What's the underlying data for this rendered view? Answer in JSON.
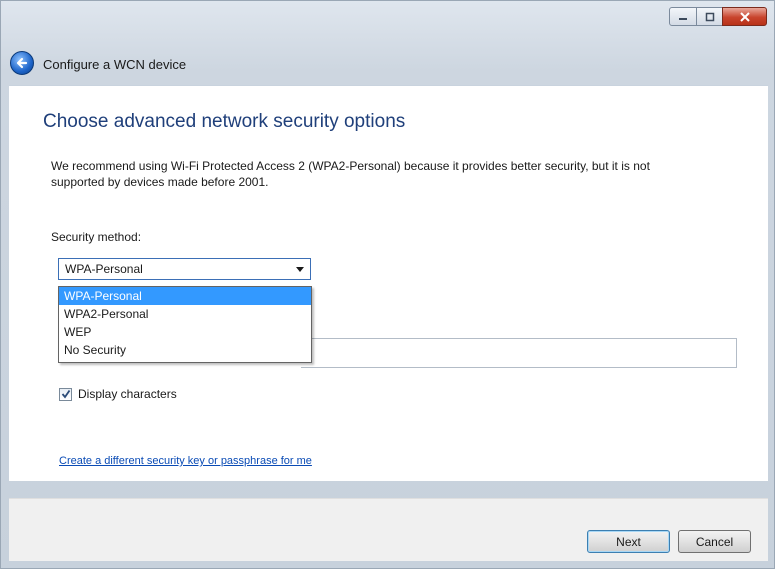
{
  "window": {
    "title": "Configure a WCN device",
    "controls": {
      "minimize": "minimize-icon",
      "maximize": "maximize-icon",
      "close": "close-icon"
    }
  },
  "page": {
    "heading": "Choose advanced network security options",
    "description": "We recommend using Wi-Fi Protected Access 2 (WPA2-Personal) because it provides better security,  but it is not supported by devices made before 2001."
  },
  "security": {
    "label": "Security method:",
    "selected": "WPA-Personal",
    "options": [
      "WPA-Personal",
      "WPA2-Personal",
      "WEP",
      "No Security"
    ]
  },
  "display_characters": {
    "label": "Display characters",
    "checked": true
  },
  "link": {
    "text": "Create a different security key or passphrase for me"
  },
  "buttons": {
    "next": "Next",
    "cancel": "Cancel"
  },
  "colors": {
    "heading": "#1f3f7a",
    "link": "#0a4bb5",
    "selection": "#3399ff"
  }
}
